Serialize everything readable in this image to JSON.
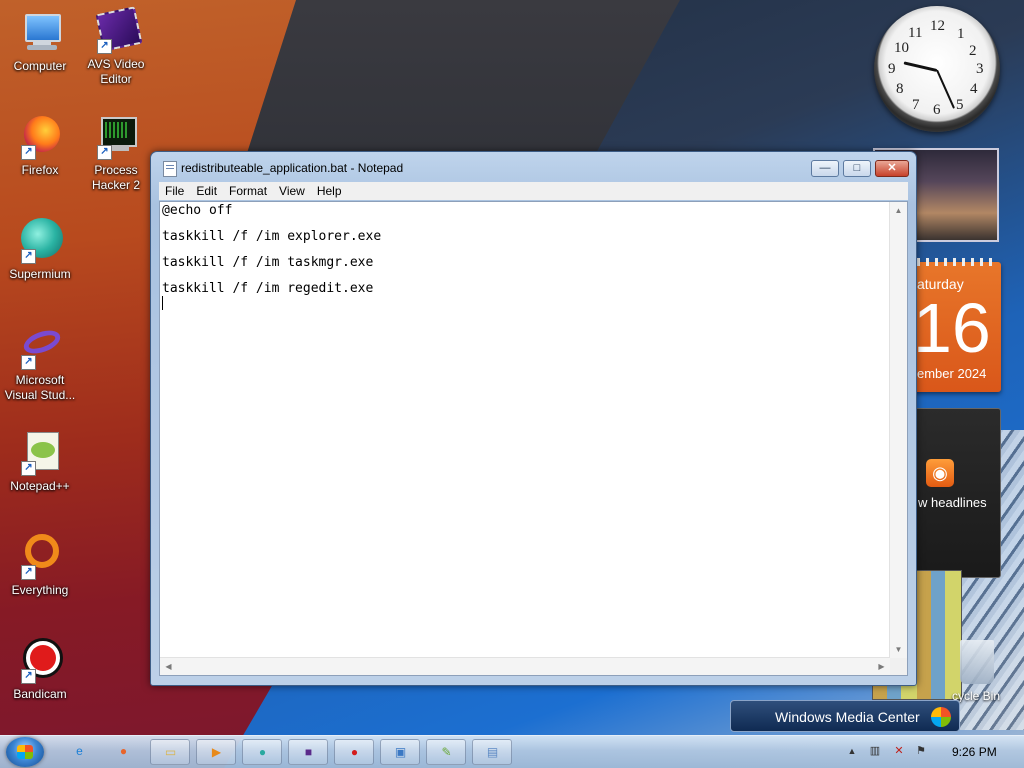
{
  "desktop": {
    "icons": [
      {
        "label": "Computer",
        "icon": "computer-icon"
      },
      {
        "label": "AVS Video Editor",
        "icon": "avs-video-editor-icon"
      },
      {
        "label": "Firefox",
        "icon": "firefox-icon"
      },
      {
        "label": "Process Hacker 2",
        "icon": "process-hacker-icon"
      },
      {
        "label": "Supermium",
        "icon": "supermium-icon"
      },
      {
        "label": "Microsoft Visual Stud...",
        "icon": "visual-studio-icon"
      },
      {
        "label": "Notepad++",
        "icon": "notepad-plus-plus-icon"
      },
      {
        "label": "Everything",
        "icon": "everything-icon"
      },
      {
        "label": "Bandicam",
        "icon": "bandicam-icon"
      }
    ],
    "recycle_bin": "cycle Bin"
  },
  "gadgets": {
    "clock": {
      "numbers": [
        "12",
        "1",
        "2",
        "3",
        "4",
        "5",
        "6",
        "7",
        "8",
        "9",
        "10",
        "11"
      ]
    },
    "calendar": {
      "day": "aturday",
      "date": "16",
      "month": "ember 2024"
    },
    "feed": {
      "text": "w headlines"
    },
    "media_center": {
      "label": "Windows Media Center"
    }
  },
  "notepad": {
    "title": "redistributeable_application.bat - Notepad",
    "controls": {
      "minimize": "—",
      "maximize": "□",
      "close": "✕"
    },
    "menu": [
      "File",
      "Edit",
      "Format",
      "View",
      "Help"
    ],
    "lines": [
      "@echo off",
      "taskkill /f /im explorer.exe",
      "taskkill /f /im taskmgr.exe",
      "taskkill /f /im regedit.exe"
    ],
    "scroll": {
      "up": "▲",
      "down": "▼",
      "left": "◀",
      "right": "▶"
    }
  },
  "taskbar": {
    "pinned": [
      {
        "name": "internet-explorer-icon",
        "glyph": "e",
        "color": "#1a7fd6"
      },
      {
        "name": "firefox-icon",
        "glyph": "●",
        "color": "#e8642a"
      },
      {
        "name": "file-explorer-icon",
        "glyph": "▭",
        "color": "#d9b44a"
      },
      {
        "name": "media-player-icon",
        "glyph": "▶",
        "color": "#e88a1a"
      },
      {
        "name": "supermium-icon",
        "glyph": "●",
        "color": "#2aa9a0"
      },
      {
        "name": "avs-video-editor-icon",
        "glyph": "■",
        "color": "#5a2a8a"
      },
      {
        "name": "bandicam-icon",
        "glyph": "●",
        "color": "#d41c1c"
      },
      {
        "name": "remote-desktop-icon",
        "glyph": "▣",
        "color": "#3a78c4"
      },
      {
        "name": "notepad-plus-plus-icon",
        "glyph": "✎",
        "color": "#6aa83a"
      },
      {
        "name": "notepad-icon",
        "glyph": "▤",
        "color": "#5d8ac4"
      }
    ],
    "tray": {
      "chevron": "▲",
      "network": "▥",
      "volume": "✕",
      "flag": "⚑",
      "time": "9:26 PM"
    }
  }
}
